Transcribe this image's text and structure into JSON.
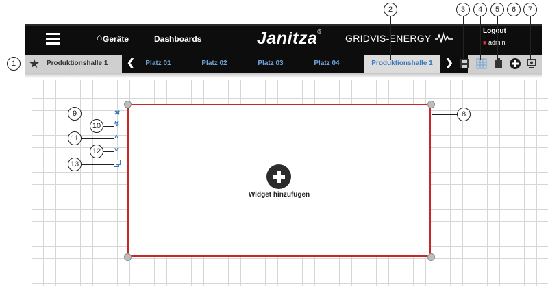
{
  "callouts": [
    "1",
    "2",
    "3",
    "4",
    "5",
    "6",
    "7",
    "8",
    "9",
    "10",
    "11",
    "12",
    "13"
  ],
  "topbar": {
    "menu_icon": "hamburger-menu-icon",
    "home_icon": "home-icon",
    "devices_label": "Geräte",
    "dashboards_label": "Dashboards",
    "logo_text": "Janitza",
    "logo_mark": "®",
    "product_text": "GRIDVIS-ENERGY",
    "logout_label": "Logout",
    "user_name": "admin"
  },
  "tabbar": {
    "home_tab": "Produktionshalle 1",
    "tabs": [
      "Platz 01",
      "Platz 02",
      "Platz 03",
      "Platz 04",
      "Produktionshalle 1"
    ],
    "active_index": 4,
    "tools": [
      "save-icon",
      "grid-icon",
      "clipboard-icon",
      "add-widget-icon",
      "presentation-icon"
    ]
  },
  "widget": {
    "add_label": "Widget hinzufügen",
    "side_icons": [
      "close-icon",
      "wrench-icon",
      "move-up-icon",
      "move-down-icon",
      "copy-icon"
    ]
  },
  "colors": {
    "topbar": "#0d0d0d",
    "tab_link": "#6fa3d8",
    "widget_border": "#c62828",
    "side_icon": "#3a7ab8"
  }
}
